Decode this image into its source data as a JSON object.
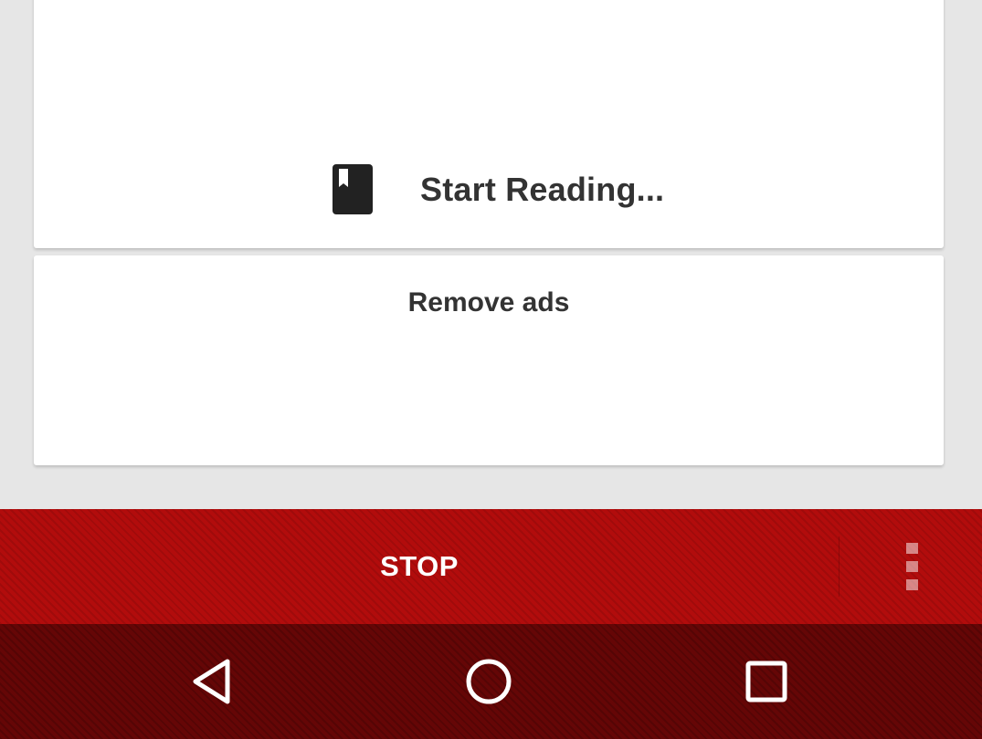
{
  "reading": {
    "start_label": "Start Reading...",
    "icon": "book-bookmark-icon"
  },
  "ads": {
    "remove_label": "Remove ads"
  },
  "action_bar": {
    "stop_label": "STOP",
    "menu_icon": "overflow-menu-icon",
    "color": "#b20c0c"
  },
  "nav_bar": {
    "color": "#650606",
    "buttons": [
      "back-icon",
      "home-icon",
      "recents-icon"
    ]
  },
  "colors": {
    "background": "#e6e6e6",
    "card": "#ffffff",
    "text": "#333333"
  }
}
